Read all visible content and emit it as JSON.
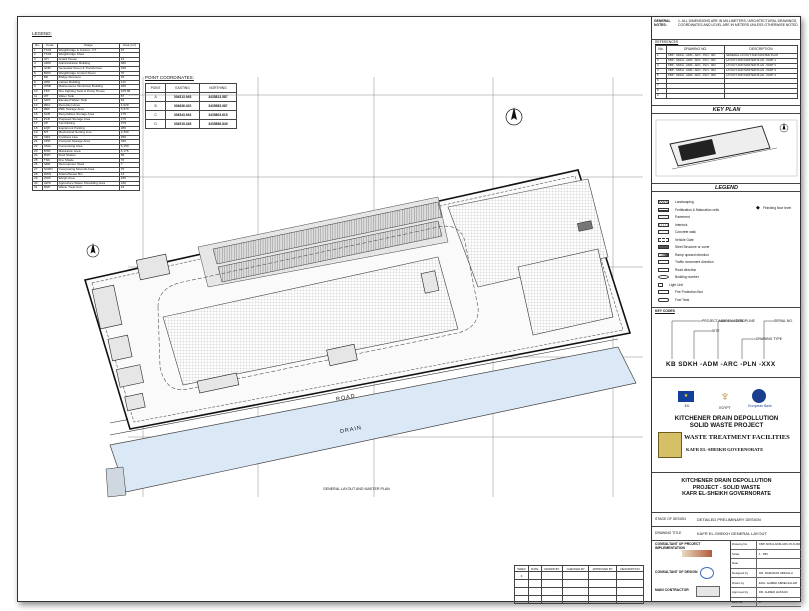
{
  "legend": {
    "title": "LEGEND:"
  },
  "buildings_table": {
    "headers": [
      "No.",
      "Code",
      "Usage",
      "Area (m²)"
    ],
    "rows": [
      [
        "1",
        "TC01",
        "Weighbridge & Control - FT",
        "97"
      ],
      [
        "2",
        "TC02",
        "Weighbridge Shed",
        ""
      ],
      [
        "3",
        "GH",
        "Guard House",
        "14"
      ],
      [
        "4",
        "ADM",
        "Administration Building",
        "480"
      ],
      [
        "5",
        "GNR",
        "Generator Room & Transformer",
        "230"
      ],
      [
        "6",
        "BWC",
        "Weighbridge Control Room",
        "70"
      ],
      [
        "7",
        "BD",
        "Bridge Structure",
        "33"
      ],
      [
        "8",
        "LBR",
        "Labour Building",
        "112"
      ],
      [
        "9",
        "WSB",
        "Maintenance Workshop Building",
        "480"
      ],
      [
        "10",
        "FFP",
        "Fire Fighting Tank & Pump House",
        "105.68"
      ],
      [
        "11",
        "WT",
        "Water Tank",
        "87"
      ],
      [
        "12",
        "SWT",
        "Elevated Water Tank",
        "64"
      ],
      [
        "13",
        "RDA",
        "Reception Area",
        "1,020"
      ],
      [
        "14",
        "RDF",
        "RDF Storage Area",
        "3,370"
      ],
      [
        "15",
        "SCB",
        "Recyclables Storage Area",
        "175"
      ],
      [
        "16",
        "PLB",
        "Prepared Storage Area",
        "175"
      ],
      [
        "17",
        "CP",
        "Car Parking",
        "279"
      ],
      [
        "18",
        "EQP",
        "Equipment Parking",
        "280"
      ],
      [
        "19",
        "MT",
        "Mechanical Sorting Line",
        "2,300"
      ],
      [
        "20",
        "CRS",
        "Crushers Line",
        "256"
      ],
      [
        "21",
        "CPD",
        "Compost Storage Area",
        "330"
      ],
      [
        "22",
        "CMA",
        "Composting Area",
        "6,150"
      ],
      [
        "23",
        "MTR",
        "Maturation Area",
        "4,176"
      ],
      [
        "24",
        "RSH",
        "Roof Shelter",
        "95"
      ],
      [
        "25",
        "TNK",
        "Fire Shade",
        "70"
      ],
      [
        "26",
        "SDR",
        "Decomposer Shed",
        "7"
      ],
      [
        "27",
        "SCRN",
        "Composting Mounds Area",
        "70"
      ],
      [
        "28",
        "DWS",
        "Drains/Sewer Bin",
        "13"
      ],
      [
        "29",
        "WLB",
        "Weigh Area",
        "180"
      ],
      [
        "30",
        "AWS",
        "Agriculture Waste Shredding Area",
        "240"
      ],
      [
        "31",
        "RSP",
        "Waste Treat Unit",
        "24"
      ]
    ]
  },
  "point_coordinates": {
    "title": "POINT COORDINATES:",
    "headers": [
      "POINT",
      "EASTING",
      "NORTHING"
    ],
    "rows": [
      [
        "A",
        "304513.945",
        "3435813.587"
      ],
      [
        "B",
        "304836.402",
        "3435983.987"
      ],
      [
        "C",
        "304543.943",
        "3435803.615"
      ],
      [
        "D",
        "304515.345",
        "3435856.849"
      ]
    ]
  },
  "plan": {
    "road_label": "ROAD",
    "drain_label": "DRAIN",
    "caption": "GENERAL LAYOUT AND MASTER PLAN"
  },
  "general_notes": {
    "title": "GENERAL NOTES:",
    "text": "1- ALL DIMENSIONS ARE IN MILLIMETERS / ARCHITECTURAL DRAWINGS, COORDINATES AND LEVEL ARE IN METERS UNLESS OTHERWISE NOTED"
  },
  "references": {
    "title": "REFERENCES",
    "headers": [
      "No.",
      "DRAWING NO.",
      "DESCRIPTION"
    ],
    "rows": [
      [
        "1",
        "KBP - SDKH - ADM - ARC - PLN - 001",
        "GENERAL LAYOUT AND MASTER PLAN"
      ],
      [
        "2",
        "KBP - SDKH - ADM - ARC - PLN - 002",
        "LAYOUT AND MASTER PLAN - PART 1"
      ],
      [
        "3",
        "KBP - SDKH - ADM - ARC - PLN - 003",
        "LAYOUT AND MASTER PLAN - PART 2"
      ],
      [
        "4",
        "KBP - SDKH - ADM - ARC - PLN - 004",
        "LAYOUT AND MASTER PLAN - PART 3"
      ],
      [
        "5",
        "KBP - SDKH - ADM - ARC - PLN - 005",
        "LAYOUT AND MASTER PLAN - PART 4"
      ],
      [
        "6",
        "",
        ""
      ],
      [
        "7",
        "",
        ""
      ],
      [
        "8",
        "",
        ""
      ],
      [
        "9",
        "",
        ""
      ]
    ]
  },
  "key_plan": {
    "title": "KEY PLAN"
  },
  "legend_panel": {
    "title": "LEGEND",
    "items": [
      "Landscaping",
      "Fertilization & Maturation cells",
      "Pavement",
      "Interlock",
      "Concrete walk",
      "Vehicle Gate",
      "Steel Structure or cover",
      "Ramp upward direction",
      "Traffic movement direction",
      "Road direction",
      "Building number",
      "Light Unit",
      "Fire Protection Box",
      "Fuel Tank"
    ],
    "side_item": "Finishing floor level"
  },
  "key_codes": {
    "title": "KEY CODES",
    "code_string": "KB SDKH -ADM -ARC -PLN -XXX",
    "labels": [
      "PROJECT ABBREVIATION",
      "SITE",
      "DISCIPLINE",
      "DRAWING TYPE",
      "SERIAL NO."
    ]
  },
  "logos": {
    "left": "EU",
    "middle": "EGYPT",
    "right": "European Bank"
  },
  "project_box": {
    "line1": "KITCHENER DRAIN DEPOLLUTION",
    "line2": "SOLID WASTE PROJECT",
    "facility": "WASTE TREATMENT FACILITIES",
    "gov": "KAFR EL-SHEIKH GOVERNORATE"
  },
  "title_block": {
    "line1": "KITCHENER DRAIN DEPOLLUTION",
    "line2": "PROJECT - SOLID WASTE",
    "line3": "KAFR EL-SHEIKH GOVERNORATE",
    "stage_label": "STAGE OF DESIGN",
    "stage_value": "DETAILED PRELIMINARY DESIGN",
    "drawing_title_label": "DRAWING TITLE",
    "drawing_title_value": "KAFR EL-SHEIKH GENERAL LAYOUT",
    "consultant_impl": "CONSULTANT OF PROJECT IMPLEMENTATION",
    "consultant_design": "CONSULTANT OF DESIGN",
    "main_contractor": "MAIN CONTRACTOR",
    "sign_rows": [
      [
        "Drawing No.",
        "KBP-SDKH-ADM-ARC-PLN-001"
      ],
      [
        "Scale",
        "1 : 850"
      ],
      [
        "Date",
        ""
      ],
      [
        "Designed by",
        "DR. RAMADAN ABDALLA"
      ],
      [
        "Drawn by",
        "ENG. AHMED ABDELSALAM"
      ],
      [
        "Approved by",
        "DR. AHMED HASSAN"
      ],
      [
        "Rev. No.",
        "0"
      ]
    ]
  },
  "revision_table": {
    "headers": [
      "INDEX",
      "DATE",
      "DRAWN BY",
      "CHECKED BY",
      "APPROVED BY",
      "DESCRIPTION"
    ],
    "rows": [
      [
        "0",
        "",
        "",
        "",
        "",
        ""
      ]
    ]
  }
}
